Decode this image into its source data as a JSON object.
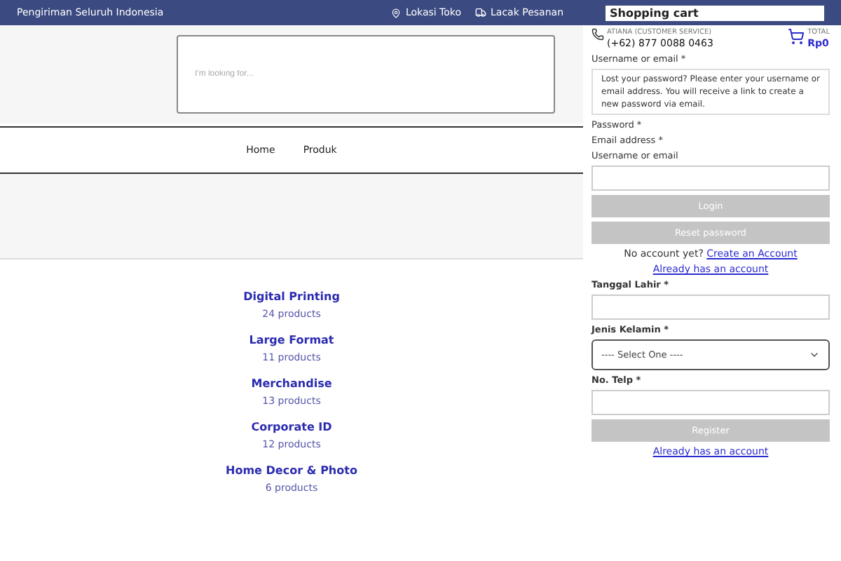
{
  "top_bar": {
    "promo": "Pengiriman Seluruh Indonesia",
    "links": [
      {
        "kind": "location",
        "label": "Lokasi Toko"
      },
      {
        "kind": "track",
        "label": "Lacak Pesanan"
      }
    ],
    "cart_title": "Shopping cart"
  },
  "header": {
    "search_placeholder": "I'm looking for...",
    "support": {
      "name": "ATIANA (CUSTOMER SERVICE)",
      "phone": "(+62) 877 0088 0463"
    },
    "cart": {
      "label": "TOTAL",
      "total": "Rp0"
    }
  },
  "nav": [
    {
      "label": "Home"
    },
    {
      "label": "Produk"
    }
  ],
  "categories": [
    {
      "name": "Digital Printing",
      "count": "24 products"
    },
    {
      "name": "Large Format",
      "count": "11 products"
    },
    {
      "name": "Merchandise",
      "count": "13 products"
    },
    {
      "name": "Corporate ID",
      "count": "12 products"
    },
    {
      "name": "Home Decor & Photo",
      "count": "6 products"
    }
  ],
  "login_form": {
    "username_label": "Username or email *",
    "lost_password_note": "Lost your password? Please enter your username or email address. You will receive a link to create a new password via email.",
    "password_label": "Password *",
    "email_label": "Email address *",
    "username_label_2": "Username or email",
    "login_button": "Login",
    "reset_button": "Reset password",
    "no_account": "No account yet?",
    "create_link": "Create an Account",
    "already_link": "Already has an account"
  },
  "register_form": {
    "fields": [
      {
        "kind": "input",
        "label": "Tanggal Lahir *"
      },
      {
        "kind": "select",
        "label": "Jenis Kelamin *",
        "value": "---- Select One ----"
      },
      {
        "kind": "input",
        "label": "No. Telp *"
      }
    ],
    "register_button": "Register",
    "already_link": "Already has an account"
  }
}
